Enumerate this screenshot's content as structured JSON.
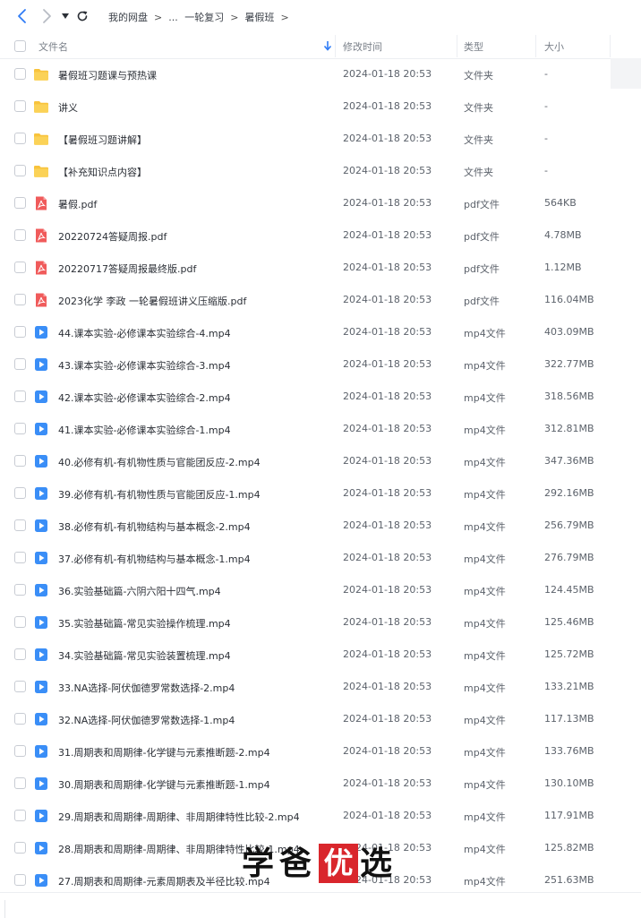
{
  "breadcrumb": [
    "我的网盘",
    "...",
    "一轮复习",
    "暑假班"
  ],
  "columns": {
    "name": "文件名",
    "modified": "修改时间",
    "type": "类型",
    "size": "大小"
  },
  "colors": {
    "accent": "#2f7cf6",
    "folder": "#f8c33c",
    "pdf": "#f05b5b",
    "video": "#3a8ef7"
  },
  "files": [
    {
      "icon": "folder",
      "name": "暑假班习题课与预热课",
      "modified": "2024-01-18 20:53",
      "type": "文件夹",
      "size": "-"
    },
    {
      "icon": "folder",
      "name": "讲义",
      "modified": "2024-01-18 20:53",
      "type": "文件夹",
      "size": "-"
    },
    {
      "icon": "folder",
      "name": "【暑假班习题讲解】",
      "modified": "2024-01-18 20:53",
      "type": "文件夹",
      "size": "-"
    },
    {
      "icon": "folder",
      "name": "【补充知识点内容】",
      "modified": "2024-01-18 20:53",
      "type": "文件夹",
      "size": "-"
    },
    {
      "icon": "pdf",
      "name": "暑假.pdf",
      "modified": "2024-01-18 20:53",
      "type": "pdf文件",
      "size": "564KB"
    },
    {
      "icon": "pdf",
      "name": "20220724答疑周报.pdf",
      "modified": "2024-01-18 20:53",
      "type": "pdf文件",
      "size": "4.78MB"
    },
    {
      "icon": "pdf",
      "name": "20220717答疑周报最终版.pdf",
      "modified": "2024-01-18 20:53",
      "type": "pdf文件",
      "size": "1.12MB"
    },
    {
      "icon": "pdf",
      "name": "2023化学  李政  一轮暑假班讲义压缩版.pdf",
      "modified": "2024-01-18 20:53",
      "type": "pdf文件",
      "size": "116.04MB"
    },
    {
      "icon": "video",
      "name": "44.课本实验-必修课本实验综合-4.mp4",
      "modified": "2024-01-18 20:53",
      "type": "mp4文件",
      "size": "403.09MB"
    },
    {
      "icon": "video",
      "name": "43.课本实验-必修课本实验综合-3.mp4",
      "modified": "2024-01-18 20:53",
      "type": "mp4文件",
      "size": "322.77MB"
    },
    {
      "icon": "video",
      "name": "42.课本实验-必修课本实验综合-2.mp4",
      "modified": "2024-01-18 20:53",
      "type": "mp4文件",
      "size": "318.56MB"
    },
    {
      "icon": "video",
      "name": "41.课本实验-必修课本实验综合-1.mp4",
      "modified": "2024-01-18 20:53",
      "type": "mp4文件",
      "size": "312.81MB"
    },
    {
      "icon": "video",
      "name": "40.必修有机-有机物性质与官能团反应-2.mp4",
      "modified": "2024-01-18 20:53",
      "type": "mp4文件",
      "size": "347.36MB"
    },
    {
      "icon": "video",
      "name": "39.必修有机-有机物性质与官能团反应-1.mp4",
      "modified": "2024-01-18 20:53",
      "type": "mp4文件",
      "size": "292.16MB"
    },
    {
      "icon": "video",
      "name": "38.必修有机-有机物结构与基本概念-2.mp4",
      "modified": "2024-01-18 20:53",
      "type": "mp4文件",
      "size": "256.79MB"
    },
    {
      "icon": "video",
      "name": "37.必修有机-有机物结构与基本概念-1.mp4",
      "modified": "2024-01-18 20:53",
      "type": "mp4文件",
      "size": "276.79MB"
    },
    {
      "icon": "video",
      "name": "36.实验基础篇-六阴六阳十四气.mp4",
      "modified": "2024-01-18 20:53",
      "type": "mp4文件",
      "size": "124.45MB"
    },
    {
      "icon": "video",
      "name": "35.实验基础篇-常见实验操作梳理.mp4",
      "modified": "2024-01-18 20:53",
      "type": "mp4文件",
      "size": "125.46MB"
    },
    {
      "icon": "video",
      "name": "34.实验基础篇-常见实验装置梳理.mp4",
      "modified": "2024-01-18 20:53",
      "type": "mp4文件",
      "size": "125.72MB"
    },
    {
      "icon": "video",
      "name": "33.NA选择-阿伏伽德罗常数选择-2.mp4",
      "modified": "2024-01-18 20:53",
      "type": "mp4文件",
      "size": "133.21MB"
    },
    {
      "icon": "video",
      "name": "32.NA选择-阿伏伽德罗常数选择-1.mp4",
      "modified": "2024-01-18 20:53",
      "type": "mp4文件",
      "size": "117.13MB"
    },
    {
      "icon": "video",
      "name": "31.周期表和周期律-化学键与元素推断题-2.mp4",
      "modified": "2024-01-18 20:53",
      "type": "mp4文件",
      "size": "133.76MB"
    },
    {
      "icon": "video",
      "name": "30.周期表和周期律-化学键与元素推断题-1.mp4",
      "modified": "2024-01-18 20:53",
      "type": "mp4文件",
      "size": "130.10MB"
    },
    {
      "icon": "video",
      "name": "29.周期表和周期律-周期律、非周期律特性比较-2.mp4",
      "modified": "2024-01-18 20:53",
      "type": "mp4文件",
      "size": "117.91MB"
    },
    {
      "icon": "video",
      "name": "28.周期表和周期律-周期律、非周期律特性比较-1.mp4",
      "modified": "2024-01-18 20:53",
      "type": "mp4文件",
      "size": "125.82MB"
    },
    {
      "icon": "video",
      "name": "27.周期表和周期律-元素周期表及半径比较.mp4",
      "modified": "2024-01-18 20:53",
      "type": "mp4文件",
      "size": "251.63MB"
    }
  ],
  "watermark": {
    "chars": [
      "学",
      "爸",
      "优",
      "选"
    ]
  }
}
